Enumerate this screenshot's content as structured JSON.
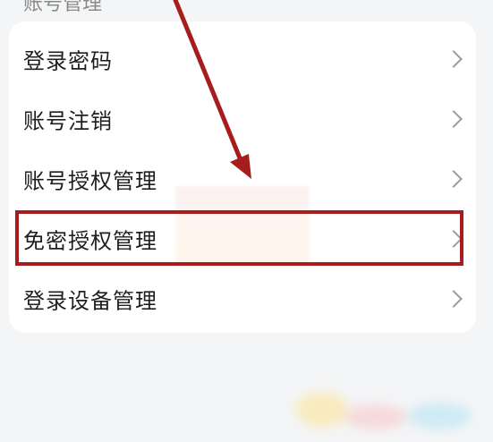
{
  "section": {
    "title": "账号管理"
  },
  "menu": {
    "items": [
      {
        "label": "登录密码"
      },
      {
        "label": "账号注销"
      },
      {
        "label": "账号授权管理"
      },
      {
        "label": "免密授权管理"
      },
      {
        "label": "登录设备管理"
      }
    ]
  },
  "colors": {
    "annotation_red": "#a51d1d",
    "chevron": "#9a9a9a",
    "background": "#f4f5f7"
  },
  "icons": {
    "chevron": "chevron-right-icon",
    "arrow": "annotation-arrow-icon"
  }
}
